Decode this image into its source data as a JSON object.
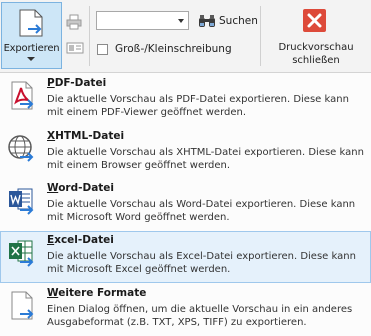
{
  "ribbon": {
    "export_label": "Exportieren",
    "search_input_value": "",
    "search_label": "Suchen",
    "match_case_label": "Groß-/Kleinschreibung",
    "close_preview_label_line1": "Druckvorschau",
    "close_preview_label_line2": "schließen"
  },
  "menu": {
    "items": [
      {
        "mnemonic": "P",
        "title_rest": "DF-Datei",
        "description": "Die aktuelle Vorschau als PDF-Datei exportieren. Diese kann mit einem PDF-Viewer geöffnet werden.",
        "icon": "pdf-icon"
      },
      {
        "mnemonic": "X",
        "title_rest": "HTML-Datei",
        "description": "Die aktuelle Vorschau als XHTML-Datei exportieren. Diese kann mit einem Browser geöffnet werden.",
        "icon": "globe-icon"
      },
      {
        "mnemonic": "W",
        "title_rest": "ord-Datei",
        "description": "Die aktuelle Vorschau als Word-Datei exportieren. Diese kann mit Microsoft Word geöffnet werden.",
        "icon": "word-icon"
      },
      {
        "mnemonic": "E",
        "title_rest": "xcel-Datei",
        "description": "Die aktuelle Vorschau als Excel-Datei exportieren. Diese kann mit Microsoft Excel geöffnet werden.",
        "icon": "excel-icon"
      },
      {
        "mnemonic": "W",
        "title_rest": "eitere Formate",
        "description": "Einen Dialog öffnen, um die aktuelle Vorschau in ein anderes Ausgabeformat (z.B. TXT, XPS, TIFF) zu exportieren.",
        "icon": "document-icon"
      }
    ],
    "highlighted_index": 3
  },
  "colors": {
    "highlight_bg": "#e5f1fb",
    "highlight_border": "#9fc8ec",
    "export_button_bg": "#cde6f7",
    "close_icon_red": "#dd4a3a",
    "arrow_blue": "#2b7bd6"
  }
}
